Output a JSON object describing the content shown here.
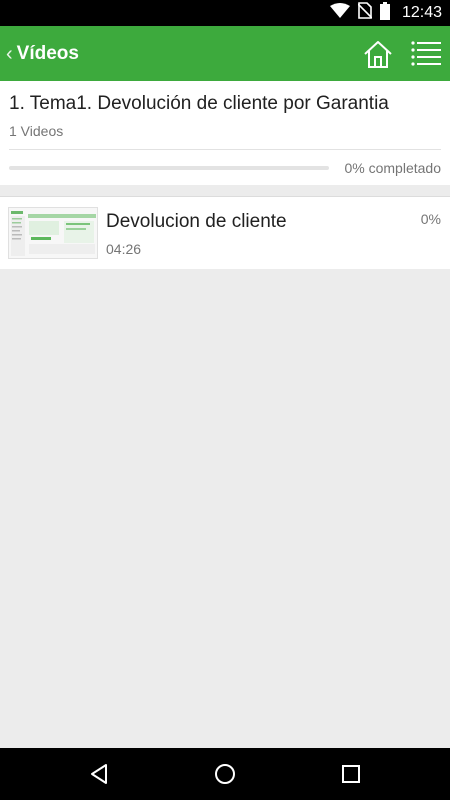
{
  "status_bar": {
    "time": "12:43",
    "icons": [
      "wifi-icon",
      "no-sim-icon",
      "battery-icon"
    ]
  },
  "app_bar": {
    "back_label": "Vídeos",
    "actions": [
      "home-icon",
      "list-menu-icon"
    ],
    "colors": {
      "primary": "#3daa3d"
    }
  },
  "topic": {
    "title": "1. Tema1. Devolución de cliente por Garantia",
    "count": "1 Videos",
    "progress": 0,
    "progress_label": "0% completado"
  },
  "videos": [
    {
      "title": "Devolucion de cliente",
      "duration": "04:26",
      "progress": "0%"
    }
  ],
  "nav_bar": {
    "buttons": [
      "back-icon",
      "home-circle-icon",
      "recents-icon"
    ]
  }
}
